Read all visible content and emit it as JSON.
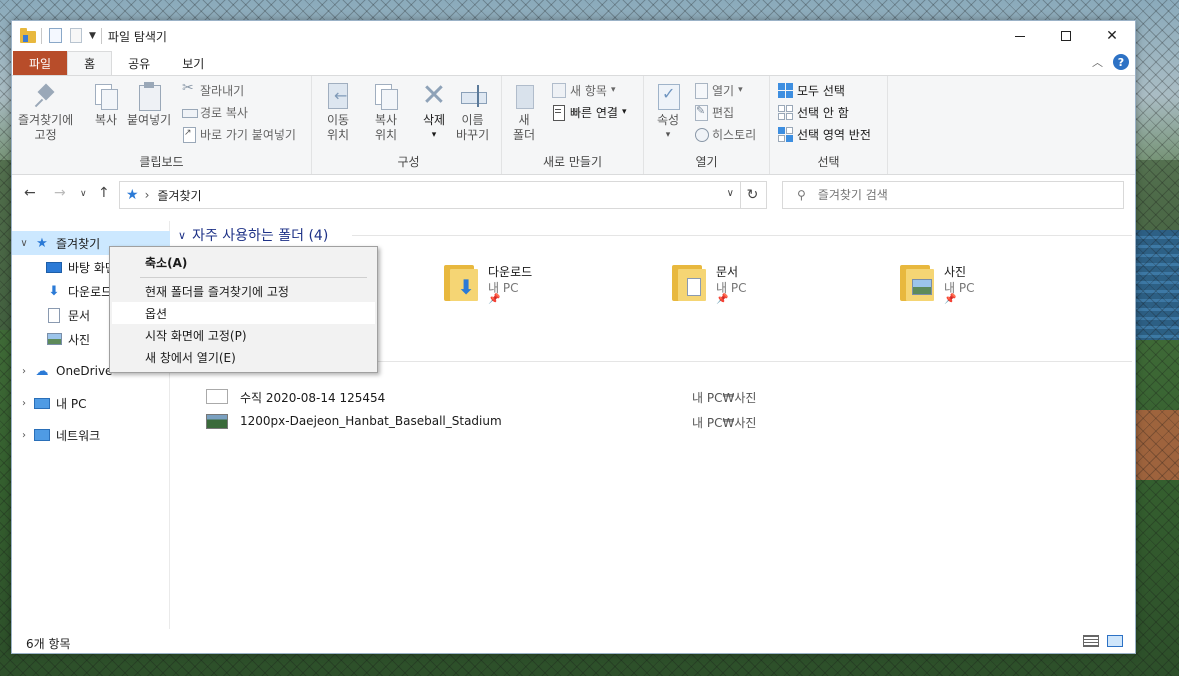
{
  "window": {
    "title": "파일 탐색기"
  },
  "ribbon_tabs": [
    "파일",
    "홈",
    "공유",
    "보기"
  ],
  "ribbon": {
    "clipboard": {
      "pin_label_1": "즐겨찾기에",
      "pin_label_2": "고정",
      "copy": "복사",
      "paste": "붙여넣기",
      "cut": "잘라내기",
      "copy_path": "경로 복사",
      "paste_shortcut": "바로 가기 붙여넣기",
      "group": "클립보드"
    },
    "organize": {
      "move_1": "이동",
      "move_2": "위치",
      "copy_1": "복사",
      "copy_2": "위치",
      "delete": "삭제",
      "rename_1": "이름",
      "rename_2": "바꾸기",
      "group": "구성"
    },
    "new": {
      "new_folder_1": "새",
      "new_folder_2": "폴더",
      "new_item": "새 항목",
      "easy_access": "빠른 연결",
      "group": "새로 만들기"
    },
    "open": {
      "properties": "속성",
      "open": "열기",
      "edit": "편집",
      "history": "히스토리",
      "group": "열기"
    },
    "select": {
      "select_all": "모두 선택",
      "select_none": "선택 안 함",
      "invert": "선택 영역 반전",
      "group": "선택"
    }
  },
  "address": {
    "path": "즐겨찾기",
    "search_placeholder": "즐겨찾기 검색"
  },
  "nav": {
    "quick_access": "즐겨찾기",
    "desktop": "바탕 화면",
    "downloads": "다운로드",
    "documents": "문서",
    "pictures": "사진",
    "onedrive": "OneDrive",
    "this_pc": "내 PC",
    "network": "네트워크"
  },
  "frequent": {
    "header": "자주 사용하는 폴더 (4)",
    "folders": [
      {
        "name": "다운로드",
        "location": "내 PC"
      },
      {
        "name": "문서",
        "location": "내 PC"
      },
      {
        "name": "사진",
        "location": "내 PC"
      }
    ]
  },
  "recent": [
    {
      "name": "수직 2020-08-14 125454",
      "location": "내 PC₩사진"
    },
    {
      "name": "1200px-Daejeon_Hanbat_Baseball_Stadium",
      "location": "내 PC₩사진"
    }
  ],
  "context_menu": {
    "items": [
      "축소(A)",
      "현재 폴더를 즐겨찾기에 고정",
      "옵션",
      "시작 화면에 고정(P)",
      "새 창에서 열기(E)"
    ]
  },
  "status": {
    "count": "6개 항목"
  },
  "colors": {
    "file_tab": "#b84d2a",
    "accent": "#2b7ad6",
    "section_header": "#1e3287",
    "selection": "#cce8ff"
  }
}
